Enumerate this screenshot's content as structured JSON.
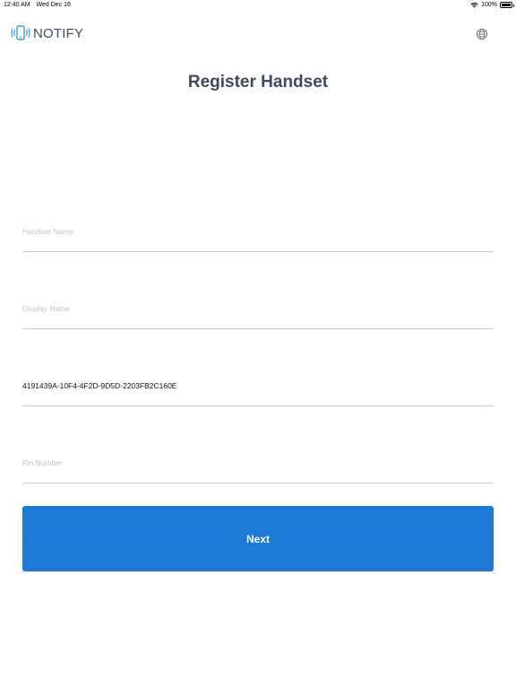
{
  "status_bar": {
    "time": "12:40 AM",
    "date": "Wed Dec 16",
    "battery": "100%",
    "battery_level": 1.0,
    "icons": [
      "wifi-icon",
      "battery-icon"
    ]
  },
  "header": {
    "logo_text": "NOTIFY",
    "logo_icon": "phone-vibrate-icon",
    "language_icon": "globe-icon"
  },
  "title": "Register Handset",
  "form": {
    "handset_name": {
      "value": "",
      "placeholder": "Handset Name"
    },
    "display_name": {
      "value": "",
      "placeholder": "Display Name"
    },
    "device_id": {
      "value": "4191439A-10F4-4F2D-9D5D-2203FB2C160E",
      "placeholder": ""
    },
    "pin_number": {
      "value": "",
      "placeholder": "Pin Number"
    }
  },
  "next_button": {
    "label": "Next"
  },
  "colors": {
    "accent": "#1d78d6",
    "title": "#3b4a5c",
    "logo_icon": "#3aa0e0",
    "placeholder": "#c1c4c8",
    "divider": "#c9cdd1"
  }
}
